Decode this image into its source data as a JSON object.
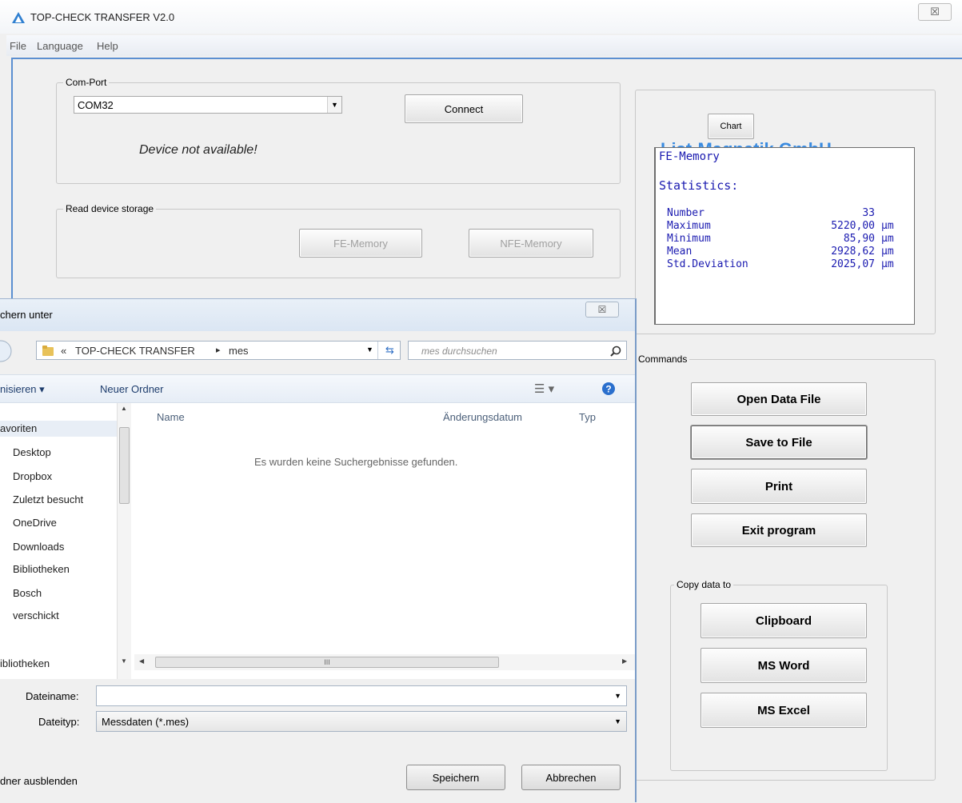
{
  "window": {
    "title": "TOP-CHECK TRANSFER V2.0",
    "close_glyph": "☒"
  },
  "menu": [
    "File",
    "Language",
    "Help"
  ],
  "com_port": {
    "legend": "Com-Port",
    "selected": "COM32",
    "connect_label": "Connect",
    "status": "Device not available!"
  },
  "device_storage": {
    "legend": "Read device storage",
    "fe_label": "FE-Memory",
    "nfe_label": "NFE-Memory"
  },
  "company": {
    "name": "List-Magnetik GmbH",
    "chart_label": "Chart",
    "memory": "FE-Memory",
    "stats_heading": "Statistics:",
    "stats": [
      {
        "label": "Number",
        "value": "33",
        "unit": ""
      },
      {
        "label": "Maximum",
        "value": "5220,00",
        "unit": "µm"
      },
      {
        "label": "Minimum",
        "value": "85,90",
        "unit": "µm"
      },
      {
        "label": "Mean",
        "value": "2928,62",
        "unit": "µm"
      },
      {
        "label": "Std.Deviation",
        "value": "2025,07",
        "unit": "µm"
      }
    ],
    "accent_color": "#3a8be0"
  },
  "commands": {
    "legend": "Commands",
    "open": "Open Data File",
    "save": "Save to File",
    "print": "Print",
    "exit": "Exit program",
    "copy_legend": "Copy data to",
    "clipboard": "Clipboard",
    "word": "MS Word",
    "excel": "MS Excel"
  },
  "dialog": {
    "title": "chern unter",
    "close_glyph": "☒",
    "path_prefix": "«",
    "path_folder": "TOP-CHECK TRANSFER",
    "path_sep": "▸",
    "path_current": "mes",
    "search_placeholder": "mes durchsuchen",
    "organize": "nisieren ▾",
    "new_folder": "Neuer Ordner",
    "nav": [
      "avoriten",
      "Desktop",
      "Dropbox",
      "Zuletzt besucht",
      "OneDrive",
      "Downloads",
      "Bibliotheken",
      "Bosch",
      "verschickt",
      "ibliotheken"
    ],
    "columns": {
      "name": "Name",
      "date": "Änderungsdatum",
      "type": "Typ"
    },
    "empty_message": "Es wurden keine Suchergebnisse gefunden.",
    "scrollbar_grip": "III",
    "filename_label": "Dateiname:",
    "filename_value": "",
    "filetype_label": "Dateityp:",
    "filetype_value": "Messdaten (*.mes)",
    "hide_folders": "dner ausblenden",
    "save_btn": "Speichern",
    "cancel_btn": "Abbrechen"
  }
}
